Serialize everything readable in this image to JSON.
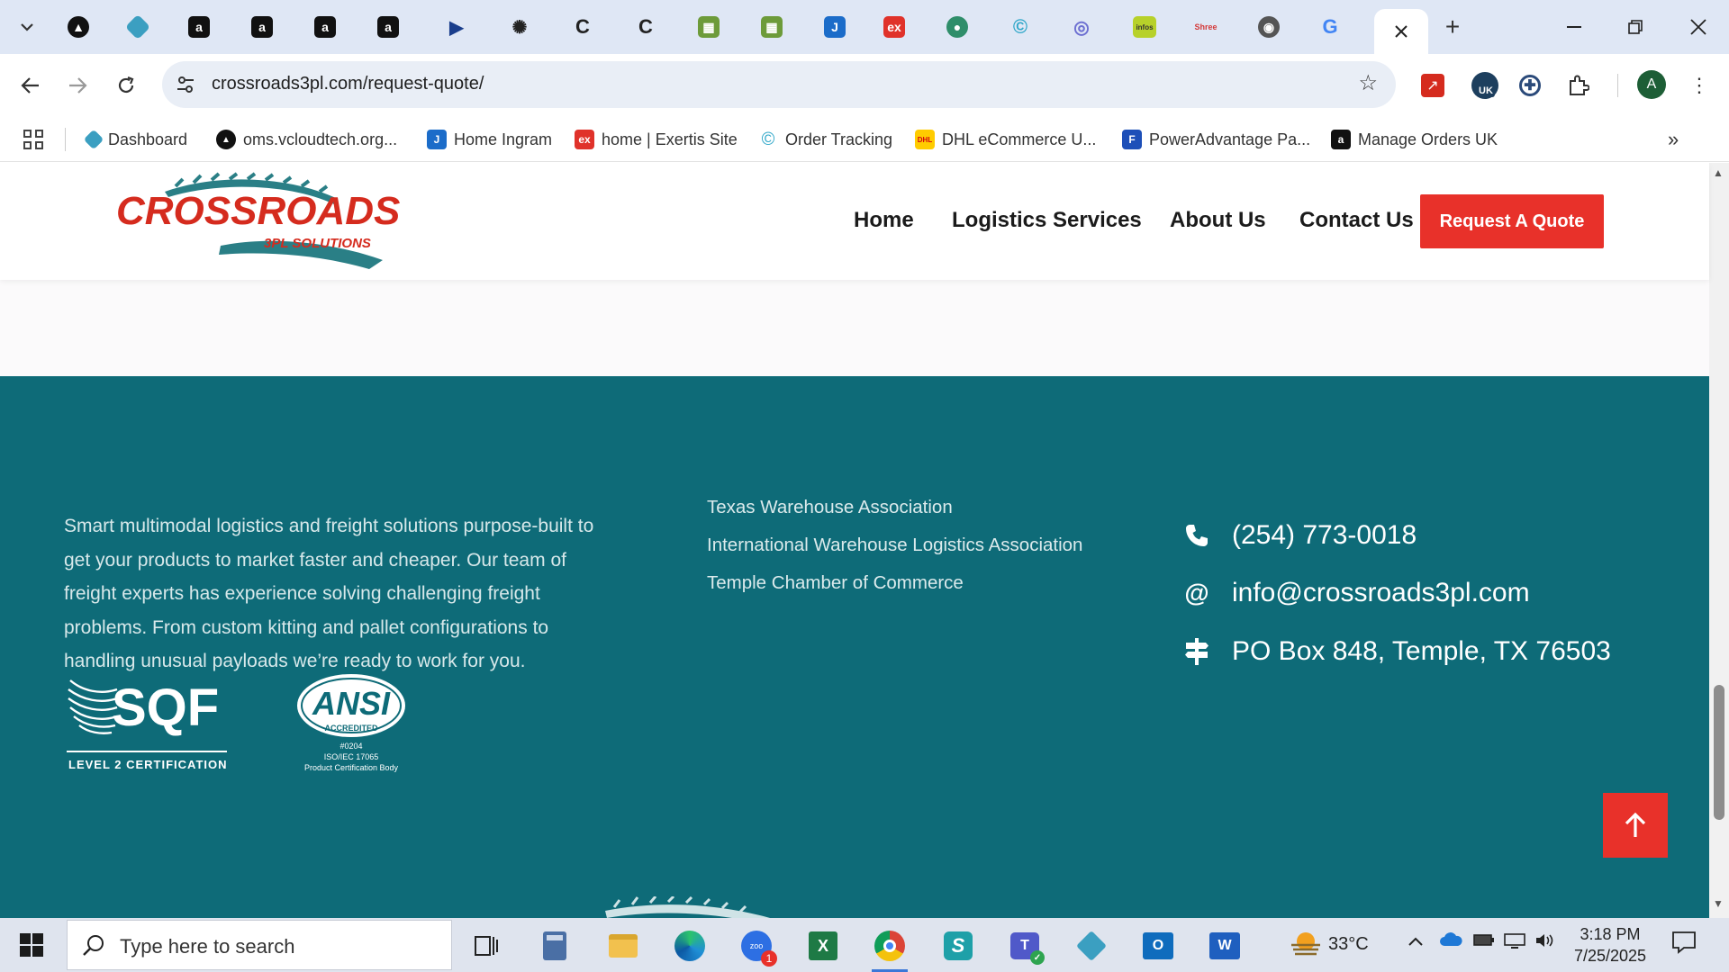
{
  "browser": {
    "url": "crossroads3pl.com/request-quote/",
    "tabs": [
      {
        "icon": "openai-icon",
        "label": ""
      },
      {
        "icon": "kite-icon",
        "label": ""
      },
      {
        "icon": "amazon-icon",
        "label": ""
      },
      {
        "icon": "amazon-icon",
        "label": ""
      },
      {
        "icon": "amazon-icon",
        "label": ""
      },
      {
        "icon": "amazon-icon",
        "label": ""
      },
      {
        "icon": "play-arrow-icon",
        "label": ""
      },
      {
        "icon": "openai-icon",
        "label": ""
      },
      {
        "icon": "c-logo-icon",
        "label": ""
      },
      {
        "icon": "c-logo-icon",
        "label": ""
      },
      {
        "icon": "warehouse-icon",
        "label": ""
      },
      {
        "icon": "warehouse-icon",
        "label": ""
      },
      {
        "icon": "ingram-icon",
        "label": ""
      },
      {
        "icon": "exertis-icon",
        "label": ""
      },
      {
        "icon": "green-circle-icon",
        "label": ""
      },
      {
        "icon": "c-swirl-icon",
        "label": ""
      },
      {
        "icon": "blue-circle-icon",
        "label": ""
      },
      {
        "icon": "infos-icon",
        "label": "infos"
      },
      {
        "icon": "shree-icon",
        "label": "Shree"
      },
      {
        "icon": "chrome-icon",
        "label": ""
      },
      {
        "icon": "google-icon",
        "label": ""
      }
    ],
    "bookmarks": [
      {
        "icon": "kite-icon",
        "label": "Dashboard"
      },
      {
        "icon": "oms-icon",
        "label": "oms.vcloudtech.org..."
      },
      {
        "icon": "ingram-icon",
        "label": "Home Ingram"
      },
      {
        "icon": "exertis-icon",
        "label": "home | Exertis Site"
      },
      {
        "icon": "c-swirl-icon",
        "label": "Order Tracking"
      },
      {
        "icon": "dhl-icon",
        "label": "DHL eCommerce U..."
      },
      {
        "icon": "poweradvantage-icon",
        "label": "PowerAdvantage Pa..."
      },
      {
        "icon": "amazon-icon",
        "label": "Manage Orders UK"
      }
    ]
  },
  "site": {
    "nav": [
      "Home",
      "Logistics Services",
      "About Us",
      "Contact Us"
    ],
    "cta": "Request A Quote",
    "logo": {
      "name": "CROSSROADS",
      "tagline": "3PL SOLUTIONS"
    },
    "footer": {
      "about": "Smart multimodal logistics and freight solutions purpose-built to get your products to market faster and cheaper. Our team of freight experts has experience solving challenging freight problems. From custom kitting and pallet configurations to handling unusual payloads we’re ready to work for you.",
      "certs": {
        "sqf": {
          "title": "SQF",
          "subtitle": "LEVEL 2 CERTIFICATION"
        },
        "ansi": {
          "title": "ANSI",
          "badge": "ACCREDITED",
          "line1": "#0204",
          "line2": "ISO/IEC 17065",
          "line3": "Product Certification Body"
        }
      },
      "links": [
        "Texas Warehouse Association",
        "International Warehouse Logistics Association",
        "Temple Chamber of Commerce"
      ],
      "phone": "(254) 773-0018",
      "email": "info@crossroads3pl.com",
      "address": "PO Box 848, Temple, TX 76503"
    }
  },
  "taskbar": {
    "search_placeholder": "Type here to search",
    "weather": "33°C",
    "time": "3:18 PM",
    "date": "7/25/2025",
    "zoom_badge": "1"
  }
}
